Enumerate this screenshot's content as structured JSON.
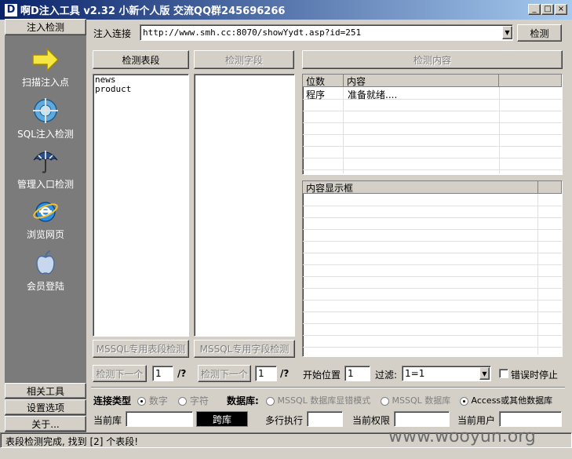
{
  "window": {
    "title": "啊D注入工具 v2.32 小新个人版 交流QQ群245696266",
    "logo": "D"
  },
  "sidebar": {
    "header": "注入检测",
    "items": [
      {
        "label": "扫描注入点",
        "icon": "arrow-right-icon"
      },
      {
        "label": "SQL注入检测",
        "icon": "globe-target-icon"
      },
      {
        "label": "管理入口检测",
        "icon": "umbrella-icon"
      },
      {
        "label": "浏览网页",
        "icon": "internet-explorer-icon"
      },
      {
        "label": "会员登陆",
        "icon": "apple-icon"
      }
    ],
    "bottom": [
      "相关工具",
      "设置选项",
      "关于..."
    ]
  },
  "toolbar": {
    "url_label": "注入连接",
    "url_value": "http://www.smh.cc:8070/showYydt.asp?id=251",
    "detect_button": "检测"
  },
  "panels": {
    "tables_button": "检测表段",
    "fields_button": "检测字段",
    "content_button": "检测内容",
    "tables": [
      "news",
      "product"
    ],
    "mssql_tables_button": "MSSQL专用表段检测",
    "mssql_fields_button": "MSSQL专用字段检测"
  },
  "content_table": {
    "headers": [
      "位数",
      "内容"
    ],
    "rows": [
      {
        "pos": "程序",
        "content": "准备就绪...."
      }
    ]
  },
  "display_box": {
    "header": "内容显示框"
  },
  "paging": {
    "next_button_1": "检测下一个",
    "page_1": "1",
    "suffix_1": "/?",
    "next_button_2": "检测下一个",
    "page_2": "1",
    "suffix_2": "/?",
    "start_label": "开始位置",
    "start_value": "1",
    "filter_label": "过滤:",
    "filter_value": "1=1",
    "stop_on_error": "错误时停止"
  },
  "connection": {
    "type_label": "连接类型",
    "type_numeric": "数字",
    "type_string": "字符",
    "db_label": "数据库:",
    "db_options": [
      "MSSQL 数据库显错模式",
      "MSSQL 数据库",
      "Access或其他数据库"
    ]
  },
  "bottom_row": {
    "current_db_label": "当前库",
    "cross_db_button": "跨库",
    "multi_exec_label": "多行执行",
    "current_perm_label": "当前权限",
    "current_user_label": "当前用户"
  },
  "status_text": "表段检测完成, 找到 [2] 个表段!",
  "watermark": "www.wooyun.org"
}
